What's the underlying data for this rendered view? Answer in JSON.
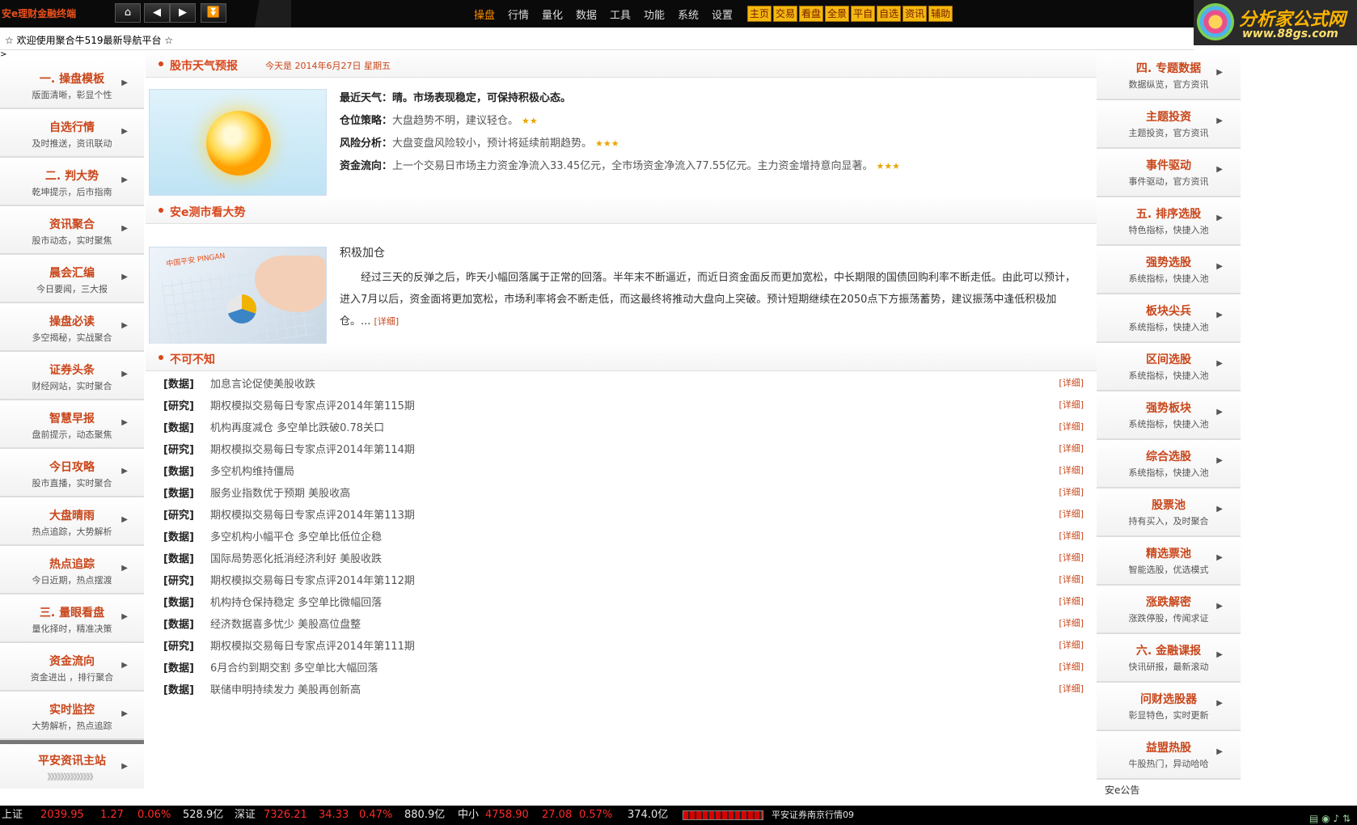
{
  "topbar": {
    "logo": "安e理财金融终端",
    "menu": [
      "操盘",
      "行情",
      "量化",
      "数据",
      "工具",
      "功能",
      "系统",
      "设置"
    ],
    "tags": [
      "主页",
      "交易",
      "看盘",
      "全景",
      "平自",
      "自选",
      "资讯",
      "辅助"
    ]
  },
  "brand": {
    "title": "分析家公式网",
    "url": "www.88gs.com"
  },
  "welcome": "☆ 欢迎使用聚合牛519最新导航平台 ☆",
  "left_nav": [
    {
      "title": "一. 操盘模板",
      "sub": "版面清晰，彰显个性"
    },
    {
      "title": "自选行情",
      "sub": "及时推送，资讯联动"
    },
    {
      "title": "二. 判大势",
      "sub": "乾坤提示，后市指南"
    },
    {
      "title": "资讯聚合",
      "sub": "股市动态，实时聚焦"
    },
    {
      "title": "晨会汇编",
      "sub": "今日要闻，三大报"
    },
    {
      "title": "操盘必读",
      "sub": "多空揭秘，实战聚合"
    },
    {
      "title": "证券头条",
      "sub": "财经网站，实时聚合"
    },
    {
      "title": "智慧早报",
      "sub": "盘前提示，动态聚焦"
    },
    {
      "title": "今日攻略",
      "sub": "股市直播，实时聚合"
    },
    {
      "title": "大盘晴雨",
      "sub": "热点追踪，大势解析"
    },
    {
      "title": "热点追踪",
      "sub": "今日近期，热点摆渡"
    },
    {
      "title": "三. 量眼看盘",
      "sub": "量化择时，精准决策"
    },
    {
      "title": "资金流向",
      "sub": "资金进出 ，排行聚合"
    },
    {
      "title": "实时监控",
      "sub": "大势解析，热点追踪"
    }
  ],
  "left_bottom": {
    "title": "平安资讯主站",
    "sub": "》》》》》》》》》》》》》》"
  },
  "weather": {
    "section_title": "股市天气预报",
    "date": "今天是 2014年6月27日 星期五",
    "headline": "最近天气：晴。市场表现稳定，可保持积极心态。",
    "lines": [
      {
        "label": "仓位策略：",
        "text": "大盘趋势不明，建议轻仓。",
        "stars": "★★"
      },
      {
        "label": "风险分析：",
        "text": "大盘变盘风险较小，预计将延续前期趋势。",
        "stars": "★★★"
      },
      {
        "label": "资金流向：",
        "text": "上一个交易日市场主力资金净流入33.45亿元，全市场资金净流入77.55亿元。主力资金增持意向显著。",
        "stars": "★★★"
      }
    ]
  },
  "analysis": {
    "section_title": "安e测市看大势",
    "image_logo": "中国平安 PINGAN",
    "title": "积极加仓",
    "body": "经过三天的反弹之后，昨天小幅回落属于正常的回落。半年末不断逼近，而近日资金面反而更加宽松，中长期限的国债回购利率不断走低。由此可以预计，进入7月以后，资金面将更加宽松，市场利率将会不断走低，而这最终将推动大盘向上突破。预计短期继续在2050点下方振荡蓄势，建议振荡中逢低积极加仓。...",
    "more": "[详细]"
  },
  "news": {
    "section_title": "不可不知",
    "detail_label": "[详细]",
    "items": [
      {
        "tag": "[数据]",
        "text": "加息言论促使美股收跌"
      },
      {
        "tag": "[研究]",
        "text": "期权模拟交易每日专家点评2014年第115期"
      },
      {
        "tag": "[数据]",
        "text": "机构再度减仓 多空单比跌破0.78关口"
      },
      {
        "tag": "[研究]",
        "text": "期权模拟交易每日专家点评2014年第114期"
      },
      {
        "tag": "[数据]",
        "text": "多空机构维持僵局"
      },
      {
        "tag": "[数据]",
        "text": "服务业指数优于预期 美股收高"
      },
      {
        "tag": "[研究]",
        "text": "期权模拟交易每日专家点评2014年第113期"
      },
      {
        "tag": "[数据]",
        "text": "多空机构小幅平仓 多空单比低位企稳"
      },
      {
        "tag": "[数据]",
        "text": "国际局势恶化抵消经济利好 美股收跌"
      },
      {
        "tag": "[研究]",
        "text": "期权模拟交易每日专家点评2014年第112期"
      },
      {
        "tag": "[数据]",
        "text": "机构持仓保持稳定 多空单比微幅回落"
      },
      {
        "tag": "[数据]",
        "text": "经济数据喜多忧少 美股高位盘整"
      },
      {
        "tag": "[研究]",
        "text": "期权模拟交易每日专家点评2014年第111期"
      },
      {
        "tag": "[数据]",
        "text": "6月合约到期交割 多空单比大幅回落"
      },
      {
        "tag": "[数据]",
        "text": "联储申明持续发力 美股再创新高"
      }
    ]
  },
  "right_nav": [
    {
      "title": "四. 专题数据",
      "sub": "数据纵览，官方资讯"
    },
    {
      "title": "主题投资",
      "sub": "主题投资，官方资讯"
    },
    {
      "title": "事件驱动",
      "sub": "事件驱动，官方资讯"
    },
    {
      "title": "五. 排序选股",
      "sub": "特色指标，快捷入池"
    },
    {
      "title": "强势选股",
      "sub": "系统指标，快捷入池"
    },
    {
      "title": "板块尖兵",
      "sub": "系统指标，快捷入池"
    },
    {
      "title": "区间选股",
      "sub": "系统指标，快捷入池"
    },
    {
      "title": "强势板块",
      "sub": "系统指标，快捷入池"
    },
    {
      "title": "综合选股",
      "sub": "系统指标，快捷入池"
    },
    {
      "title": "股票池",
      "sub": "持有买入，及时聚合"
    },
    {
      "title": "精选票池",
      "sub": "智能选股，优选模式"
    },
    {
      "title": "涨跌解密",
      "sub": "涨跌停股，传闻求证"
    },
    {
      "title": "六. 金融课报",
      "sub": "快讯研报，最新滚动"
    },
    {
      "title": "问财选股器",
      "sub": "彰显特色，实时更新"
    },
    {
      "title": "益盟热股",
      "sub": "牛股热门，异动哈哈"
    }
  ],
  "notice": "安e公告",
  "ticker": {
    "sh_label": "上证",
    "sh_val": "2039.95",
    "sh_chg": "1.27",
    "sh_pct": "0.06%",
    "sh_amt": "528.9亿",
    "sz_label": "深证",
    "sz_val": "7326.21",
    "sz_chg": "34.33",
    "sz_pct": "0.47%",
    "sz_amt": "880.9亿",
    "zx_label": "中小",
    "zx_val": "4758.90",
    "zx_chg": "27.08",
    "zx_pct": "0.57%",
    "zx_amt": "374.0亿",
    "server": "平安证券南京行情09"
  }
}
